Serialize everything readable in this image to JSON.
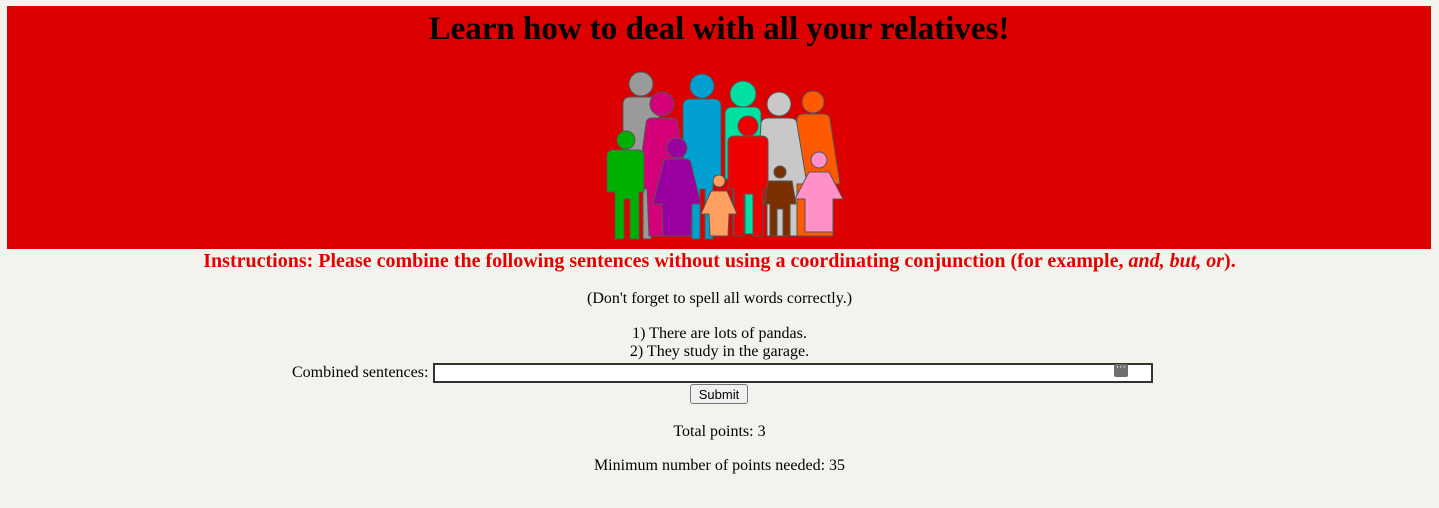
{
  "header": {
    "title": "Learn how to deal with all your relatives!",
    "banner_color": "#dc0000",
    "illustration": "family-group-silhouettes"
  },
  "instructions": {
    "prefix": "Instructions: Please combine the following sentences without using a coordinating conjunction (for example, ",
    "examples": "and, but, or",
    "suffix": ")."
  },
  "note": "(Don't forget to spell all words correctly.)",
  "sentences": [
    "1) There are lots of pandas.",
    "2) They study in the garage."
  ],
  "form": {
    "label": "Combined sentences:",
    "value": "",
    "submit_label": "Submit"
  },
  "score": {
    "total": "Total points: 3",
    "minimum": "Minimum number of points needed: 35"
  }
}
